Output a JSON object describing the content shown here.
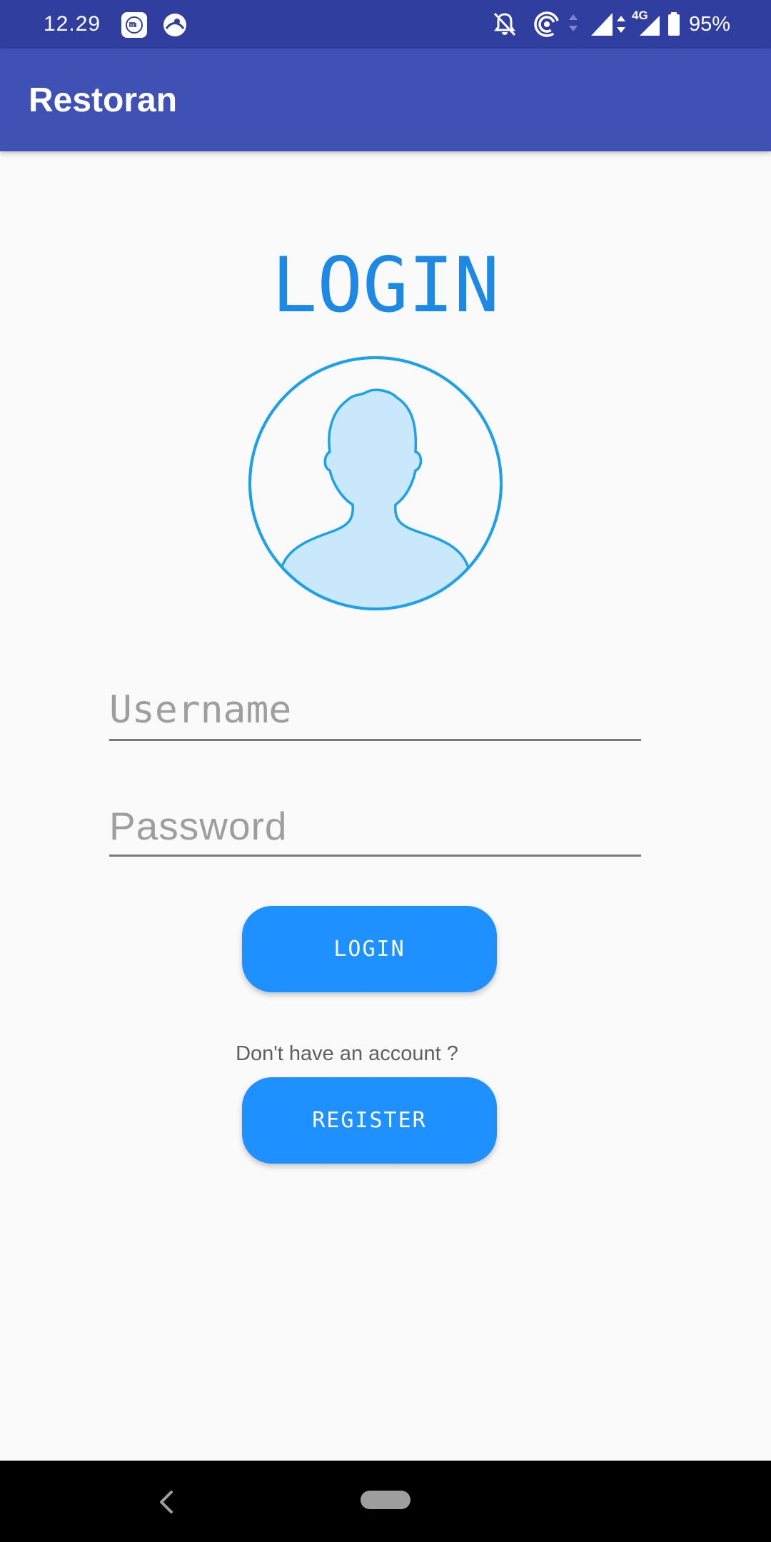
{
  "status_bar": {
    "time": "12.29",
    "notification_icons": [
      "mi-app-icon",
      "browser-icon"
    ],
    "system_icons": [
      "bell-off-icon",
      "hotspot-icon",
      "data-arrows-icon",
      "signal-icon",
      "signal-4g-icon",
      "battery-icon"
    ],
    "network_label": "4G",
    "battery": "95%"
  },
  "app_bar": {
    "title": "Restoran",
    "color": "#3F51B5"
  },
  "login": {
    "heading": "LOGIN",
    "avatar_icon": "user-avatar-icon",
    "username_placeholder": "Username",
    "username_value": "",
    "password_placeholder": "Password",
    "password_value": "",
    "login_button": "LOGIN",
    "register_prompt": "Don't have an account ?",
    "register_button": "REGISTER"
  },
  "nav_bar": {
    "back_icon": "back-chevron-icon",
    "home_icon": "home-pill-icon"
  },
  "colors": {
    "status_bar": "#303F9F",
    "accent_blue": "#1E90FF",
    "heading_blue": "#1E88E5",
    "avatar_stroke": "#1DA1E8",
    "avatar_fill": "#C9E8FB"
  }
}
